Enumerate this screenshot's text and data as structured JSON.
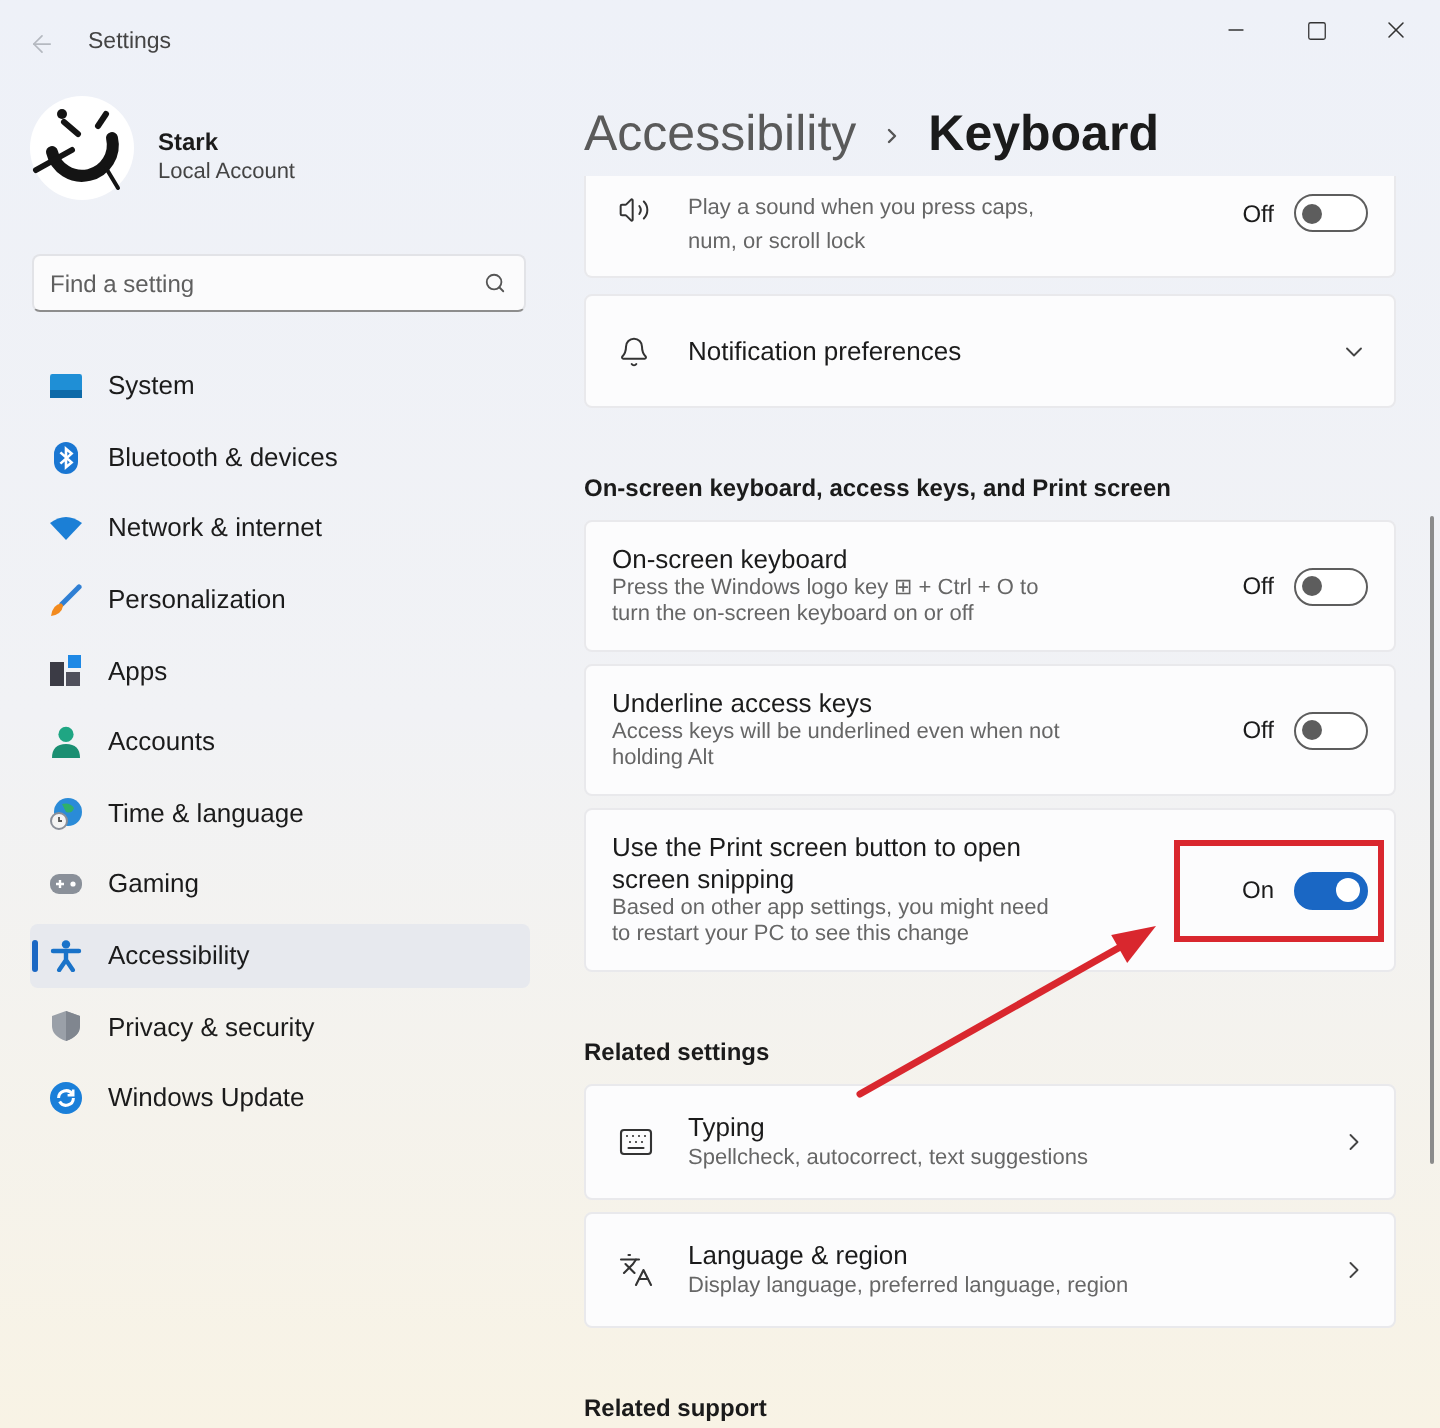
{
  "window": {
    "title": "Settings",
    "back_disabled": true
  },
  "account": {
    "name": "Stark",
    "type": "Local Account"
  },
  "search": {
    "placeholder": "Find a setting"
  },
  "sidebar": {
    "items": [
      {
        "label": "System",
        "selected": false
      },
      {
        "label": "Bluetooth & devices",
        "selected": false
      },
      {
        "label": "Network & internet",
        "selected": false
      },
      {
        "label": "Personalization",
        "selected": false
      },
      {
        "label": "Apps",
        "selected": false
      },
      {
        "label": "Accounts",
        "selected": false
      },
      {
        "label": "Time & language",
        "selected": false
      },
      {
        "label": "Gaming",
        "selected": false
      },
      {
        "label": "Accessibility",
        "selected": true
      },
      {
        "label": "Privacy & security",
        "selected": false
      },
      {
        "label": "Windows Update",
        "selected": false
      }
    ]
  },
  "header": {
    "parent": "Accessibility",
    "title": "Keyboard"
  },
  "sections": [
    {
      "cards": [
        {
          "kind": "toggle",
          "description": "Play a sound when you press caps, num, or scroll lock",
          "state_label": "Off",
          "on": false,
          "highlighted": false
        },
        {
          "kind": "expander",
          "title": "Notification preferences",
          "expanded": false
        }
      ]
    },
    {
      "heading": "On-screen keyboard, access keys, and Print screen",
      "cards": [
        {
          "kind": "toggle",
          "title": "On-screen keyboard",
          "description": "Press the Windows logo key ⊞ + Ctrl + O to turn the on-screen keyboard on or off",
          "state_label": "Off",
          "on": false,
          "highlighted": false
        },
        {
          "kind": "toggle",
          "title": "Underline access keys",
          "description": "Access keys will be underlined even when not holding Alt",
          "state_label": "Off",
          "on": false,
          "highlighted": false
        },
        {
          "kind": "toggle",
          "title": "Use the Print screen button to open screen snipping",
          "description": "Based on other app settings, you might need to restart your PC to see this change",
          "state_label": "On",
          "on": true,
          "highlighted": true
        }
      ]
    },
    {
      "heading": "Related settings",
      "cards": [
        {
          "kind": "link",
          "title": "Typing",
          "description": "Spellcheck, autocorrect, text suggestions"
        },
        {
          "kind": "link",
          "title": "Language & region",
          "description": "Display language, preferred language, region"
        }
      ]
    },
    {
      "heading": "Related support"
    }
  ]
}
